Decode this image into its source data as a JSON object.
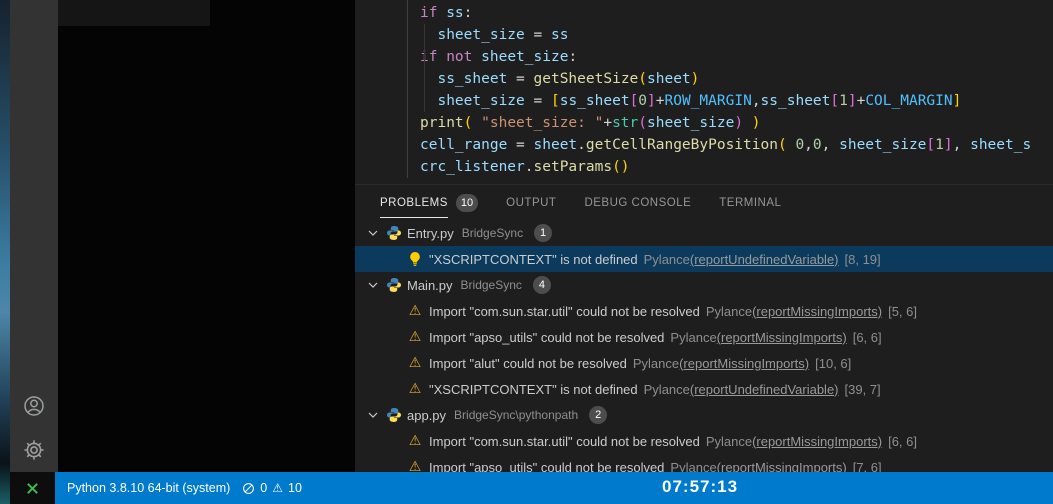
{
  "editor": {
    "code_lines": [
      {
        "indent": 0,
        "segments": [
          [
            "kw",
            "if"
          ],
          [
            "pln",
            " "
          ],
          [
            "var",
            "ss"
          ],
          [
            "pln",
            ":"
          ]
        ]
      },
      {
        "indent": 1,
        "segments": [
          [
            "var",
            "sheet_size"
          ],
          [
            "pln",
            " = "
          ],
          [
            "var",
            "ss"
          ]
        ]
      },
      {
        "indent": 0,
        "segments": [
          [
            "kw",
            "if"
          ],
          [
            "pln",
            " "
          ],
          [
            "kw",
            "not"
          ],
          [
            "pln",
            " "
          ],
          [
            "var",
            "sheet_size"
          ],
          [
            "pln",
            ":"
          ]
        ]
      },
      {
        "indent": 1,
        "segments": [
          [
            "var",
            "ss_sheet"
          ],
          [
            "pln",
            " = "
          ],
          [
            "fn",
            "getSheetSize"
          ],
          [
            "b1",
            "("
          ],
          [
            "var",
            "sheet"
          ],
          [
            "b1",
            ")"
          ]
        ]
      },
      {
        "indent": 1,
        "segments": [
          [
            "var",
            "sheet_size"
          ],
          [
            "pln",
            " = "
          ],
          [
            "b1",
            "["
          ],
          [
            "var",
            "ss_sheet"
          ],
          [
            "b2",
            "["
          ],
          [
            "num",
            "0"
          ],
          [
            "b2",
            "]"
          ],
          [
            "pln",
            "+"
          ],
          [
            "const",
            "ROW_MARGIN"
          ],
          [
            "pln",
            ","
          ],
          [
            "var",
            "ss_sheet"
          ],
          [
            "b2",
            "["
          ],
          [
            "num",
            "1"
          ],
          [
            "b2",
            "]"
          ],
          [
            "pln",
            "+"
          ],
          [
            "const",
            "COL_MARGIN"
          ],
          [
            "b1",
            "]"
          ]
        ]
      },
      {
        "indent": 0,
        "segments": [
          [
            "fn",
            "print"
          ],
          [
            "b1",
            "("
          ],
          [
            "pln",
            " "
          ],
          [
            "str",
            "\"sheet_size: \""
          ],
          [
            "pln",
            "+"
          ],
          [
            "cls",
            "str"
          ],
          [
            "b2",
            "("
          ],
          [
            "var",
            "sheet_size"
          ],
          [
            "b2",
            ")"
          ],
          [
            "pln",
            " "
          ],
          [
            "b1",
            ")"
          ]
        ]
      },
      {
        "indent": 0,
        "segments": [
          [
            "var",
            "cell_range"
          ],
          [
            "pln",
            " = "
          ],
          [
            "var",
            "sheet"
          ],
          [
            "pln",
            "."
          ],
          [
            "fn",
            "getCellRangeByPosition"
          ],
          [
            "b1",
            "("
          ],
          [
            "pln",
            " "
          ],
          [
            "num",
            "0"
          ],
          [
            "pln",
            ","
          ],
          [
            "num",
            "0"
          ],
          [
            "pln",
            ", "
          ],
          [
            "var",
            "sheet_size"
          ],
          [
            "b2",
            "["
          ],
          [
            "num",
            "1"
          ],
          [
            "b2",
            "]"
          ],
          [
            "pln",
            ", "
          ],
          [
            "var",
            "sheet_s"
          ]
        ]
      },
      {
        "indent": 0,
        "segments": [
          [
            "var",
            "crc_listener"
          ],
          [
            "pln",
            "."
          ],
          [
            "fn",
            "setParams"
          ],
          [
            "b1",
            "()"
          ]
        ]
      }
    ]
  },
  "panel": {
    "tabs": [
      {
        "label": "PROBLEMS",
        "badge": "10",
        "active": true
      },
      {
        "label": "OUTPUT",
        "active": false
      },
      {
        "label": "DEBUG CONSOLE",
        "active": false
      },
      {
        "label": "TERMINAL",
        "active": false
      }
    ],
    "problems": {
      "groups": [
        {
          "file": "Entry.py",
          "path": "BridgeSync",
          "count": "1",
          "items": [
            {
              "icon": "lightbulb",
              "selected": true,
              "message": "\"XSCRIPTCONTEXT\" is not defined",
              "source": "Pylance",
              "link": "(reportUndefinedVariable)",
              "position": "[8, 19]"
            }
          ]
        },
        {
          "file": "Main.py",
          "path": "BridgeSync",
          "count": "4",
          "items": [
            {
              "icon": "warning",
              "selected": false,
              "message": "Import \"com.sun.star.util\" could not be resolved",
              "source": "Pylance",
              "link": "(reportMissingImports)",
              "position": "[5, 6]"
            },
            {
              "icon": "warning",
              "selected": false,
              "message": "Import \"apso_utils\" could not be resolved",
              "source": "Pylance",
              "link": "(reportMissingImports)",
              "position": "[6, 6]"
            },
            {
              "icon": "warning",
              "selected": false,
              "message": "Import \"alut\" could not be resolved",
              "source": "Pylance",
              "link": "(reportMissingImports)",
              "position": "[10, 6]"
            },
            {
              "icon": "warning",
              "selected": false,
              "message": "\"XSCRIPTCONTEXT\" is not defined",
              "source": "Pylance",
              "link": "(reportUndefinedVariable)",
              "position": "[39, 7]"
            }
          ]
        },
        {
          "file": "app.py",
          "path": "BridgeSync\\pythonpath",
          "count": "2",
          "items": [
            {
              "icon": "warning",
              "selected": false,
              "message": "Import \"com.sun.star.util\" could not be resolved",
              "source": "Pylance",
              "link": "(reportMissingImports)",
              "position": "[6, 6]"
            },
            {
              "icon": "warning",
              "selected": false,
              "message": "Import \"apso_utils\" could not be resolved",
              "source": "Pylance",
              "link": "(reportMissingImports)",
              "position": "[7, 6]"
            }
          ]
        }
      ]
    }
  },
  "activity_bar": {
    "icons": [
      "account",
      "settings-gear"
    ]
  },
  "status_bar": {
    "interpreter": "Python 3.8.10 64-bit (system)",
    "errors": "0",
    "warnings": "10",
    "clock": "07:57:13"
  },
  "colors": {
    "statusbar_accent": "#007acc",
    "warning_icon": "#ddab39",
    "lightbulb_icon": "#ffcc00",
    "selection_row": "#0b3a5c",
    "editor_bg": "#1e1e1e",
    "activitybar_bg": "#333333"
  }
}
